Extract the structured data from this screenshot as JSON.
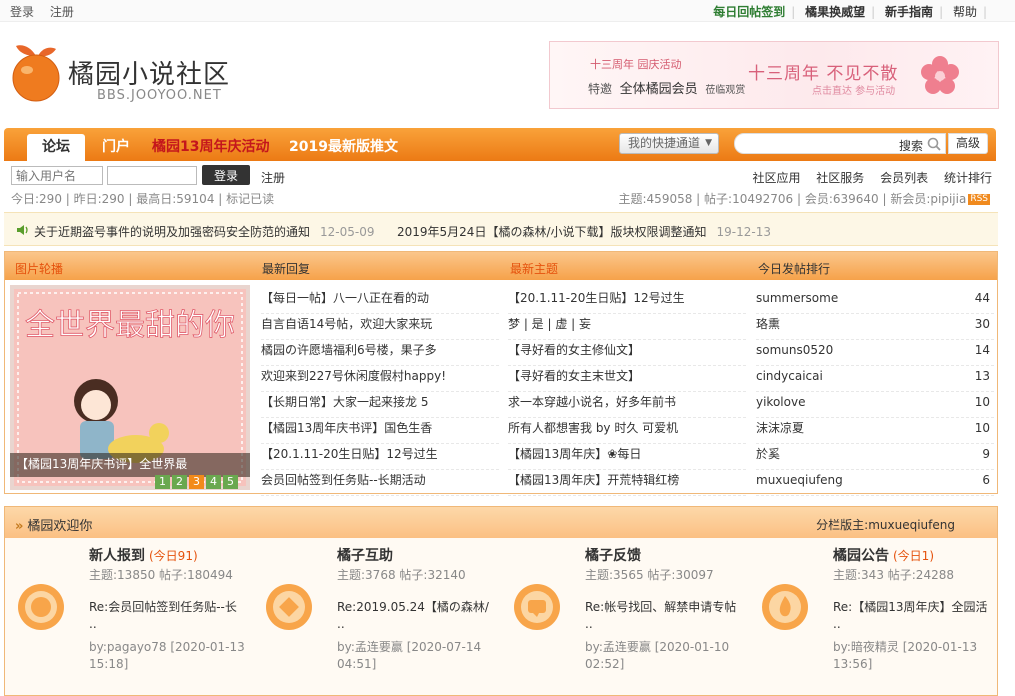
{
  "topbar": {
    "login": "登录",
    "register": "注册",
    "links": [
      "每日回帖签到",
      "橘果换威望",
      "新手指南",
      "帮助"
    ]
  },
  "header": {
    "logo_title": "橘园小说社区",
    "logo_sub": "BBS.JOOYOO.NET",
    "banner": {
      "line1": "十三周年 园庆活动",
      "line2_a": "特邀",
      "line2_b": "全体橘园会员",
      "line2_c": "莅临观赏",
      "line3": "十三周年 不见不散",
      "line4": "点击直达 参与活动"
    }
  },
  "nav": {
    "tabs": [
      {
        "label": "论坛",
        "active": true
      },
      {
        "label": "门户"
      },
      {
        "label": "橘园13周年庆活动"
      },
      {
        "label": "2019最新版推文"
      }
    ],
    "quick_label": "我的快捷通道",
    "search_label": "搜索",
    "advanced_label": "高级"
  },
  "login": {
    "user_placeholder": "输入用户名",
    "button": "登录",
    "register": "注册"
  },
  "stats": {
    "left": "今日:290 | 昨日:290 | 最高日:59104 | 标记已读",
    "right": "主题:459058 | 帖子:10492706 | 会员:639640 | 新会员:pipijia",
    "rss": "RSS"
  },
  "quicklinks": [
    "社区应用",
    "社区服务",
    "会员列表",
    "统计排行"
  ],
  "announcements": [
    {
      "text": "关于近期盗号事件的说明及加强密码安全防范的通知",
      "date": "12-05-09"
    },
    {
      "text": "2019年5月24日【橘の森林/小说下载】版块权限调整通知",
      "date": "19-12-13"
    }
  ],
  "hot": {
    "headers": [
      "图片轮播",
      "最新回复",
      "最新主题",
      "今日发帖排行"
    ],
    "slide": {
      "caption": "【橘园13周年庆书评】全世界最",
      "title_art": "全世界最甜的你",
      "pages": [
        "1",
        "2",
        "3",
        "4",
        "5"
      ],
      "active_page": "3"
    },
    "latest_replies": [
      "【每日一帖】八一八正在看的动",
      "自言自语14号帖，欢迎大家来玩",
      "橘园の许愿墙福利6号楼，果子多",
      "欢迎来到227号休闲度假村happy!",
      "【长期日常】大家一起来接龙 5",
      "【橘园13周年庆书评】国色生香",
      "【20.1.11-20生日贴】12号过生",
      "会员回帖签到任务贴--长期活动"
    ],
    "latest_topics": [
      "【20.1.11-20生日贴】12号过生",
      "梦 | 是 | 虚 | 妄",
      "【寻好看的女主修仙文】",
      "【寻好看的女主末世文】",
      "求一本穿越小说名，好多年前书",
      "所有人都想害我 by 时久 可爱机",
      "【橘园13周年庆】❀每日",
      "【橘园13周年庆】开荒特辑红榜"
    ],
    "ranking": [
      {
        "name": "summersome",
        "count": "44"
      },
      {
        "name": "珞熏",
        "count": "30"
      },
      {
        "name": "somuns0520",
        "count": "14"
      },
      {
        "name": "cindycaicai",
        "count": "13"
      },
      {
        "name": "yikolove",
        "count": "10"
      },
      {
        "name": "沫沫凉夏",
        "count": "10"
      },
      {
        "name": "於奚",
        "count": "9"
      },
      {
        "name": "muxueqiufeng",
        "count": "6"
      }
    ]
  },
  "welcome": {
    "title_prefix": "»",
    "title": "橘园欢迎你",
    "moderator": "分栏版主:muxueqiufeng",
    "forums": [
      {
        "name": "新人报到",
        "today": "(今日91)",
        "meta": "主题:13850  帖子:180494",
        "last": "Re:会员回帖签到任务贴--长 ..",
        "by": "by:pagayo78 [2020-01-13 15:18]"
      },
      {
        "name": "橘子互助",
        "today": "",
        "meta": "主题:3768  帖子:32140",
        "last": "Re:2019.05.24【橘の森林/ ..",
        "by": "by:孟连要赢 [2020-07-14 04:51]"
      },
      {
        "name": "橘子反馈",
        "today": "",
        "meta": "主题:3565  帖子:30097",
        "last": "Re:帐号找回、解禁申请专帖 ..",
        "by": "by:孟连要赢 [2020-01-10 02:52]"
      },
      {
        "name": "橘园公告",
        "today": "(今日1)",
        "meta": "主题:343  帖子:24288",
        "last": "Re:【橘园13周年庆】全园活 ..",
        "by": "by:暗夜精灵 [2020-01-13 13:56]"
      }
    ]
  },
  "colors": {
    "accent": "#f28a1a",
    "nav_red": "#c4161c",
    "topbar_green": "#2e7d32"
  }
}
